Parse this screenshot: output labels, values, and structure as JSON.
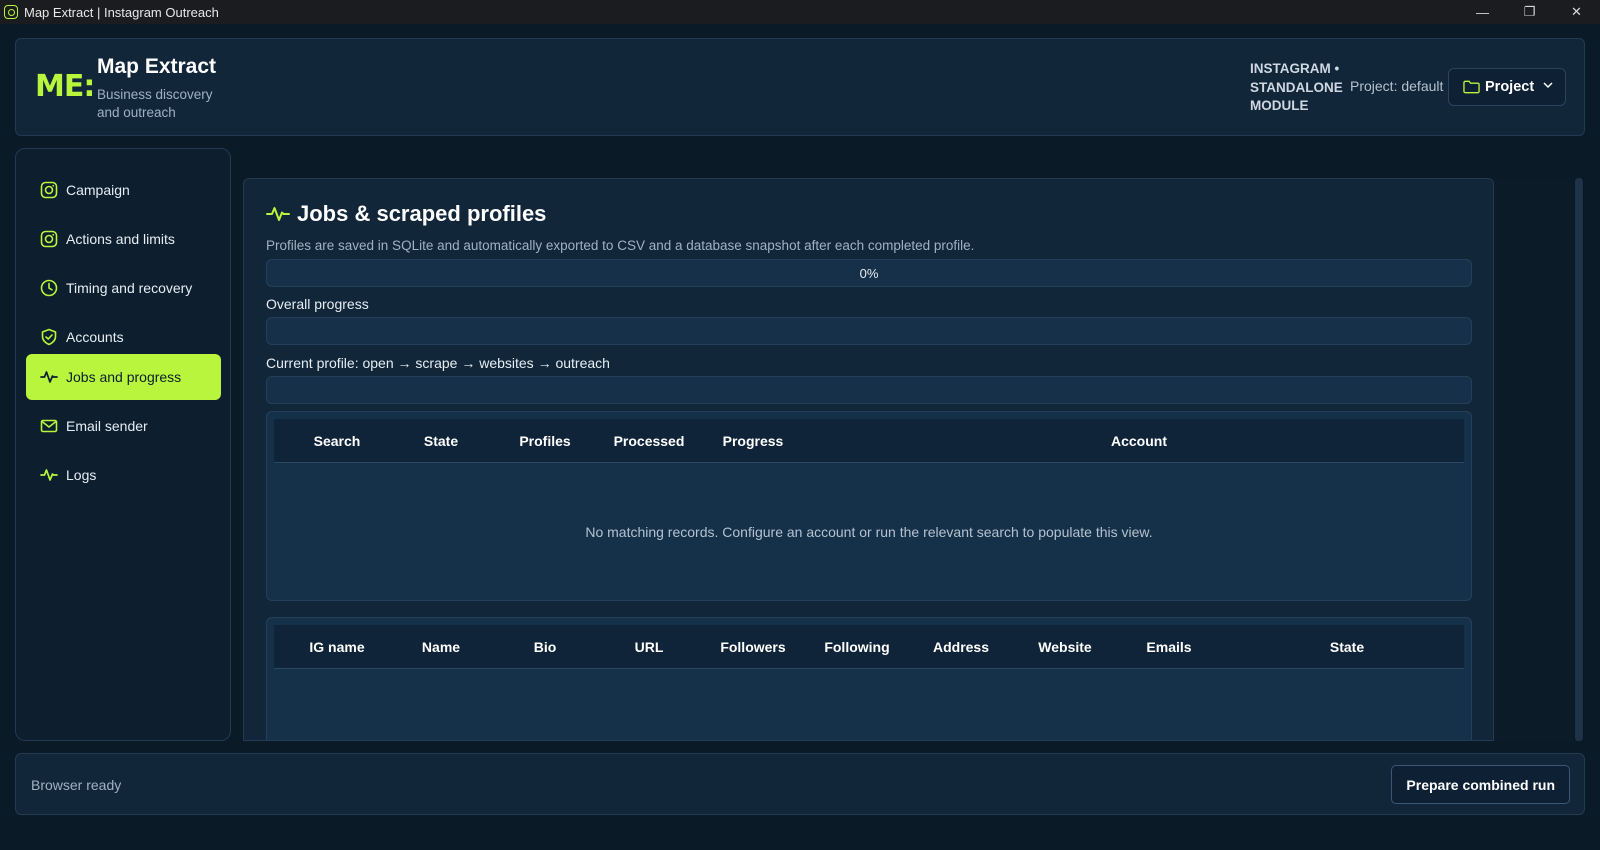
{
  "window": {
    "title": "Map Extract | Instagram Outreach",
    "controls": [
      "—",
      "❐",
      "✕"
    ]
  },
  "header": {
    "logo": "ME:",
    "title": "Map Extract",
    "subtitle": "Business discovery and outreach",
    "mode_label": "INSTAGRAM • STANDALONE MODULE",
    "project_label": "Project: default",
    "project_button": "Project"
  },
  "sidebar": {
    "items": [
      {
        "label": "Campaign",
        "icon": "instagram-icon",
        "active": false
      },
      {
        "label": "Actions and limits",
        "icon": "instagram-icon",
        "active": false
      },
      {
        "label": "Timing and recovery",
        "icon": "clock-icon",
        "active": false
      },
      {
        "label": "Accounts",
        "icon": "shield-check-icon",
        "active": false
      },
      {
        "label": "Jobs and progress",
        "icon": "activity-icon",
        "active": true
      },
      {
        "label": "Email sender",
        "icon": "mail-icon",
        "active": false
      },
      {
        "label": "Logs",
        "icon": "activity-icon",
        "active": false
      }
    ]
  },
  "main": {
    "title": "Jobs & scraped profiles",
    "description": "Profiles are saved in SQLite and automatically exported to CSV and a database snapshot after each completed profile.",
    "progress_top": {
      "text": "0%",
      "value": 0
    },
    "overall_label": "Overall progress",
    "overall_value": 0,
    "current_label": "Current profile: open → scrape → websites → outreach",
    "current_value": 0,
    "jobs_table": {
      "columns": [
        "Search",
        "State",
        "Profiles",
        "Processed",
        "Progress",
        "Account"
      ],
      "empty_message": "No matching records. Configure an account or run the relevant search to populate this view."
    },
    "profiles_table": {
      "columns": [
        "IG name",
        "Name",
        "Bio",
        "URL",
        "Followers",
        "Following",
        "Address",
        "Website",
        "Emails",
        "State"
      ]
    }
  },
  "footer": {
    "status": "Browser ready",
    "run_button": "Prepare combined run"
  },
  "colors": {
    "accent": "#b8f53c",
    "background": "#0b1a27",
    "panel": "#12263a"
  }
}
